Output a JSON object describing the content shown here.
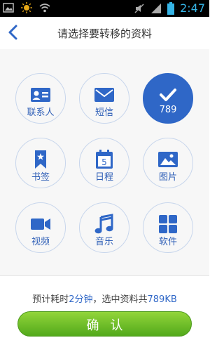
{
  "statusbar": {
    "time": "2:47"
  },
  "header": {
    "title": "请选择要转移的资料"
  },
  "items": [
    {
      "label": "联系人",
      "icon": "contact-card-icon",
      "selected": false
    },
    {
      "label": "短信",
      "icon": "envelope-icon",
      "selected": false
    },
    {
      "label": "789",
      "icon": "checkmark-icon",
      "selected": true
    },
    {
      "label": "书签",
      "icon": "bookmark-icon",
      "selected": false
    },
    {
      "label": "日程",
      "icon": "calendar-icon",
      "calendar_day": "5",
      "selected": false
    },
    {
      "label": "图片",
      "icon": "picture-icon",
      "selected": false
    },
    {
      "label": "视频",
      "icon": "video-camera-icon",
      "selected": false
    },
    {
      "label": "音乐",
      "icon": "music-note-icon",
      "selected": false
    },
    {
      "label": "软件",
      "icon": "apps-grid-icon",
      "selected": false
    }
  ],
  "footer": {
    "info_prefix": "预计耗时",
    "info_time": "2分钟",
    "info_mid": "，选中资料共",
    "info_size": "789KB",
    "confirm_label": "确认"
  },
  "colors": {
    "accent": "#2f67c7",
    "statusbar_icon": "#35b4e6",
    "button_green": "#6bbd25"
  }
}
